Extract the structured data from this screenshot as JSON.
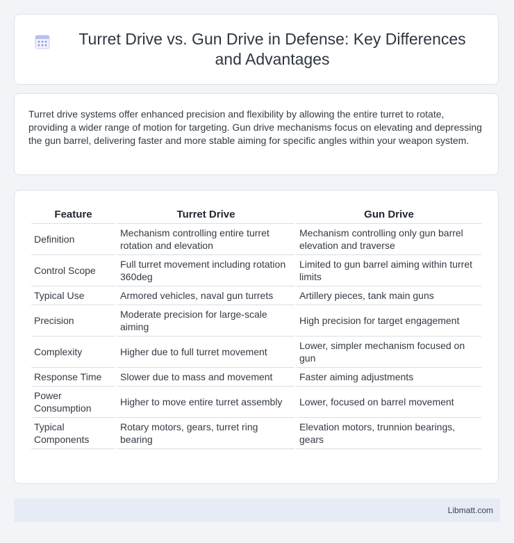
{
  "header": {
    "title": "Turret Drive vs. Gun Drive in Defense: Key Differences and Advantages",
    "icon": "calendar-grid-icon",
    "icon_color": "#7b8ce6"
  },
  "intro": {
    "text": "Turret drive systems offer enhanced precision and flexibility by allowing the entire turret to rotate, providing a wider range of motion for targeting. Gun drive mechanisms focus on elevating and depressing the gun barrel, delivering faster and more stable aiming for specific angles within your weapon system."
  },
  "table": {
    "headers": [
      "Feature",
      "Turret Drive",
      "Gun Drive"
    ],
    "rows": [
      [
        "Definition",
        "Mechanism controlling entire turret rotation and elevation",
        "Mechanism controlling only gun barrel elevation and traverse"
      ],
      [
        "Control Scope",
        "Full turret movement including rotation 360deg",
        "Limited to gun barrel aiming within turret limits"
      ],
      [
        "Typical Use",
        "Armored vehicles, naval gun turrets",
        "Artillery pieces, tank main guns"
      ],
      [
        "Precision",
        "Moderate precision for large-scale aiming",
        "High precision for target engagement"
      ],
      [
        "Complexity",
        "Higher due to full turret movement",
        "Lower, simpler mechanism focused on gun"
      ],
      [
        "Response Time",
        "Slower due to mass and movement",
        "Faster aiming adjustments"
      ],
      [
        "Power Consumption",
        "Higher to move entire turret assembly",
        "Lower, focused on barrel movement"
      ],
      [
        "Typical Components",
        "Rotary motors, gears, turret ring bearing",
        "Elevation motors, trunnion bearings, gears"
      ]
    ]
  },
  "footer": {
    "brand": "Libmatt.com"
  }
}
